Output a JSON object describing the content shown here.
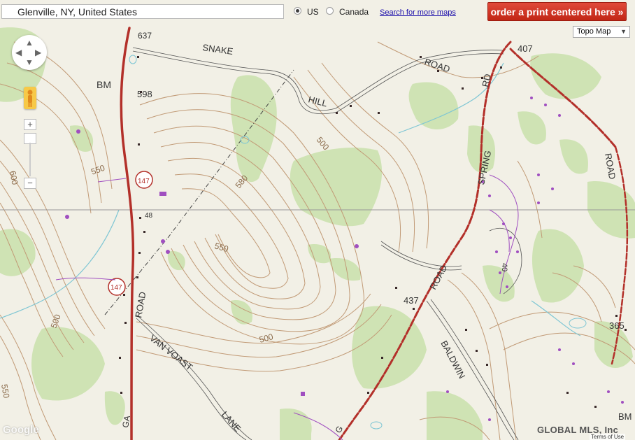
{
  "search": {
    "value": "Glenville, NY, United States"
  },
  "country_options": [
    {
      "label": "US",
      "selected": true
    },
    {
      "label": "Canada",
      "selected": false
    }
  ],
  "links": {
    "more_maps": "Search for more maps"
  },
  "order_button": {
    "label": "order a print centered here »"
  },
  "map_type": {
    "selected": "Topo Map"
  },
  "controls": {
    "zoom_in": "+",
    "zoom_out": "−"
  },
  "footer": {
    "logo": "Google",
    "watermark": "GLOBAL MLS, Inc",
    "terms": "Terms of Use"
  },
  "map_labels": {
    "snake": "SNAKE",
    "road_top": "ROAD",
    "hill": "HILL",
    "bm_top": "BM",
    "elev_637": "637",
    "elev_598": "598",
    "elev_407": "407",
    "elev_437": "437",
    "elev_365": "365",
    "c550_left": "550",
    "c600_left": "600",
    "c500_mid": "500",
    "c580": "580",
    "c550_mid": "550",
    "c500_bottom": "500",
    "c500_left": "500",
    "c550_bottom": "550",
    "route_147_top": "147",
    "route_147_bottom": "147",
    "road_vert_left": "ROAD",
    "van_voast": "VAN VOAST",
    "lane": "LANE",
    "spring": "SPRING",
    "rd": "RD",
    "road_diag": "ROAD",
    "baldwin": "BALDWIN",
    "road_right": "ROAD",
    "bm_right": "BM",
    "ga": "GA",
    "g": "G",
    "num_40": "40",
    "num_48": "48"
  },
  "colors": {
    "paper": "#f2f0e6",
    "woodland": "#cfe3b4",
    "contour": "#c19a76",
    "road": "#b3302a",
    "building": "#3a2a2a",
    "purple": "#a04fc0",
    "water": "#7ec6d4",
    "accent": "#c22716"
  }
}
